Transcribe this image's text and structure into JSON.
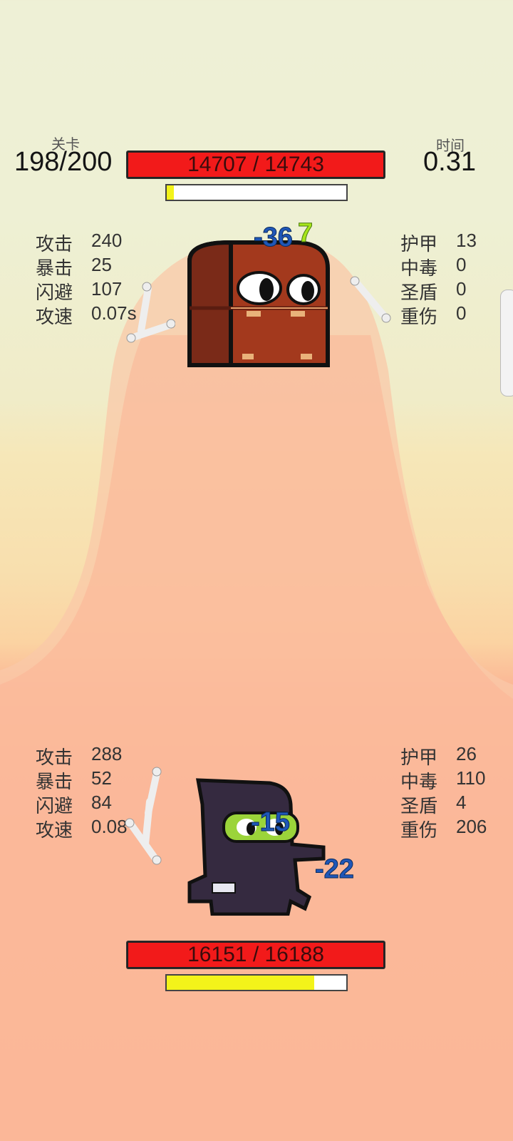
{
  "level": {
    "label": "关卡",
    "value": "198/200"
  },
  "time": {
    "label": "时间",
    "value": "0.31"
  },
  "enemy": {
    "hp_text": "14707 / 14743",
    "sub_progress": 0.04,
    "stats_left": [
      {
        "label": "攻击",
        "value": "240"
      },
      {
        "label": "暴击",
        "value": "25"
      },
      {
        "label": "闪避",
        "value": "107"
      },
      {
        "label": "攻速",
        "value": "0.07s"
      }
    ],
    "stats_right": [
      {
        "label": "护甲",
        "value": "13"
      },
      {
        "label": "中毒",
        "value": "0"
      },
      {
        "label": "圣盾",
        "value": "0"
      },
      {
        "label": "重伤",
        "value": "0"
      }
    ],
    "damage_popups": [
      "-36",
      "7"
    ]
  },
  "player": {
    "hp_text": "16151 / 16188",
    "sub_progress": 0.82,
    "stats_left": [
      {
        "label": "攻击",
        "value": "288"
      },
      {
        "label": "暴击",
        "value": "52"
      },
      {
        "label": "闪避",
        "value": "84"
      },
      {
        "label": "攻速",
        "value": "0.08"
      }
    ],
    "stats_right": [
      {
        "label": "护甲",
        "value": "26"
      },
      {
        "label": "中毒",
        "value": "110"
      },
      {
        "label": "圣盾",
        "value": "4"
      },
      {
        "label": "重伤",
        "value": "206"
      }
    ],
    "damage_popups": [
      "-15",
      "-22"
    ]
  },
  "colors": {
    "hp_red": "#f21a1a",
    "progress_yellow": "#f3f31a",
    "damage_blue": "#1f57b8",
    "heal_green": "#a7e51a"
  }
}
